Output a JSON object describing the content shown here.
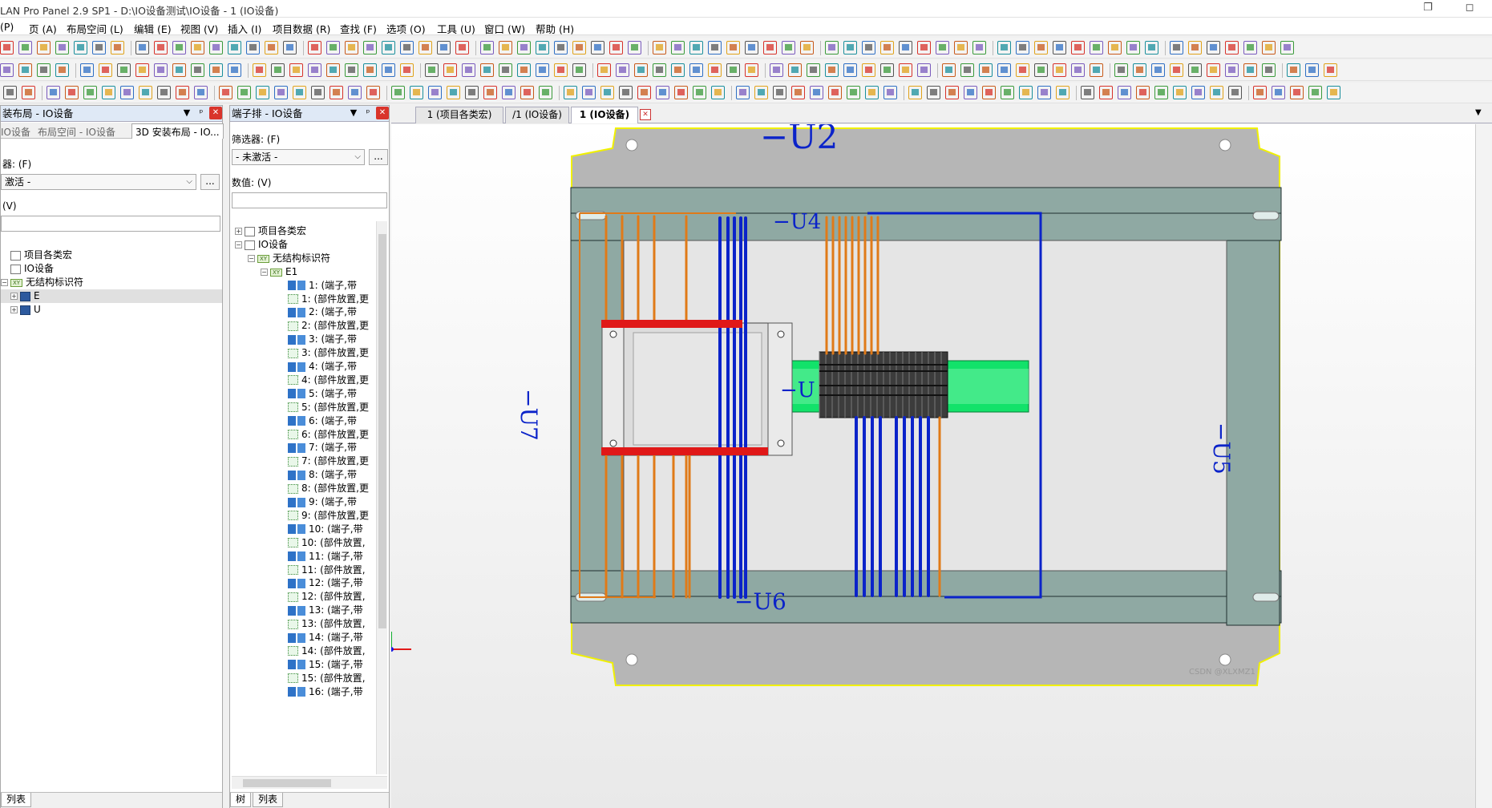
{
  "window": {
    "title": "LAN Pro Panel 2.9 SP1 - D:\\IO设备测试\\IO设备 - 1 (IO设备)",
    "restore_glyph": "❐",
    "maximize_glyph": "◻"
  },
  "menu": [
    "(P)",
    "页 (A)",
    "布局空间 (L)",
    "编辑 (E)",
    "视图 (V)",
    "插入 (I)",
    "项目数据 (R)",
    "查找 (F)",
    "选项 (O)",
    "工具 (U)",
    "窗口 (W)",
    "帮助 (H)"
  ],
  "left_panel": {
    "title": "装布局 - IO设备",
    "pin": "ᵖ",
    "close": "✕",
    "dropdown": "▼",
    "tabs": [
      "IO设备",
      "布局空间 - IO设备",
      "3D 安装布局 - IO..."
    ],
    "filter_label": "器: (F)",
    "filter_value": "激活 -",
    "dots": "...",
    "value_label": "(V)",
    "tree": [
      {
        "label": "项目各类宏",
        "indent": 0,
        "icon": "folder",
        "exp": ""
      },
      {
        "label": "IO设备",
        "indent": 0,
        "icon": "folder",
        "exp": ""
      },
      {
        "label": "无结构标识符",
        "indent": 0,
        "icon": "xy",
        "exp": "−"
      },
      {
        "label": "E",
        "indent": 1,
        "icon": "book",
        "exp": "+",
        "selected": true
      },
      {
        "label": "U",
        "indent": 1,
        "icon": "book",
        "exp": "+"
      }
    ],
    "bottom_tab": "列表"
  },
  "terminal_panel": {
    "title": "端子排 - IO设备",
    "pin": "ᵖ",
    "close": "✕",
    "dropdown": "▼",
    "filter_label": "筛选器: (F)",
    "filter_value": "- 未激活 -",
    "dots": "...",
    "value_label": "数值: (V)",
    "tree_top": [
      {
        "label": "项目各类宏",
        "indent": 0,
        "icon": "folder",
        "exp": "+"
      },
      {
        "label": "IO设备",
        "indent": 0,
        "icon": "folder",
        "exp": "−"
      },
      {
        "label": "无结构标识符",
        "indent": 1,
        "icon": "xy",
        "exp": "−"
      },
      {
        "label": "E1",
        "indent": 2,
        "icon": "xy",
        "exp": "−"
      }
    ],
    "rows": [
      "1: (端子,带",
      "1: (部件放置,更",
      "2: (端子,带",
      "2: (部件放置,更",
      "3: (端子,带",
      "3: (部件放置,更",
      "4: (端子,带",
      "4: (部件放置,更",
      "5: (端子,带",
      "5: (部件放置,更",
      "6: (端子,带",
      "6: (部件放置,更",
      "7: (端子,带",
      "7: (部件放置,更",
      "8: (端子,带",
      "8: (部件放置,更",
      "9: (端子,带",
      "9: (部件放置,更",
      "10: (端子,带",
      "10: (部件放置,",
      "11: (端子,带",
      "11: (部件放置,",
      "12: (端子,带",
      "12: (部件放置,",
      "13: (端子,带",
      "13: (部件放置,",
      "14: (端子,带",
      "14: (部件放置,",
      "15: (端子,带",
      "15: (部件放置,",
      "16: (端子,带"
    ],
    "bottom_tabs": [
      "树",
      "列表"
    ]
  },
  "doc_tabs": [
    "1 (项目各类宏)",
    "/1 (IO设备)",
    "1 (IO设备)"
  ],
  "doc_close": "✕",
  "doc_menu": "▼",
  "canvas": {
    "labels": {
      "u2": "−U2",
      "u4": "−U4",
      "u6": "−U6",
      "u7": "−U7",
      "u5": "−U5",
      "u_mid": "−U"
    },
    "watermark": "CSDN @XLXMZ1"
  },
  "colors": {
    "enclosure": "#b6b6b6",
    "rail_duct": "#8fa9a3",
    "mount_plate": "#e5e5e5",
    "din_rail": "#12e26a",
    "orange_wire": "#e07a18",
    "blue_wire": "#0b23c9",
    "terminal_red": "#e01818",
    "terminal_block": "#3c3c3c",
    "outline_yellow": "#f0f000"
  }
}
